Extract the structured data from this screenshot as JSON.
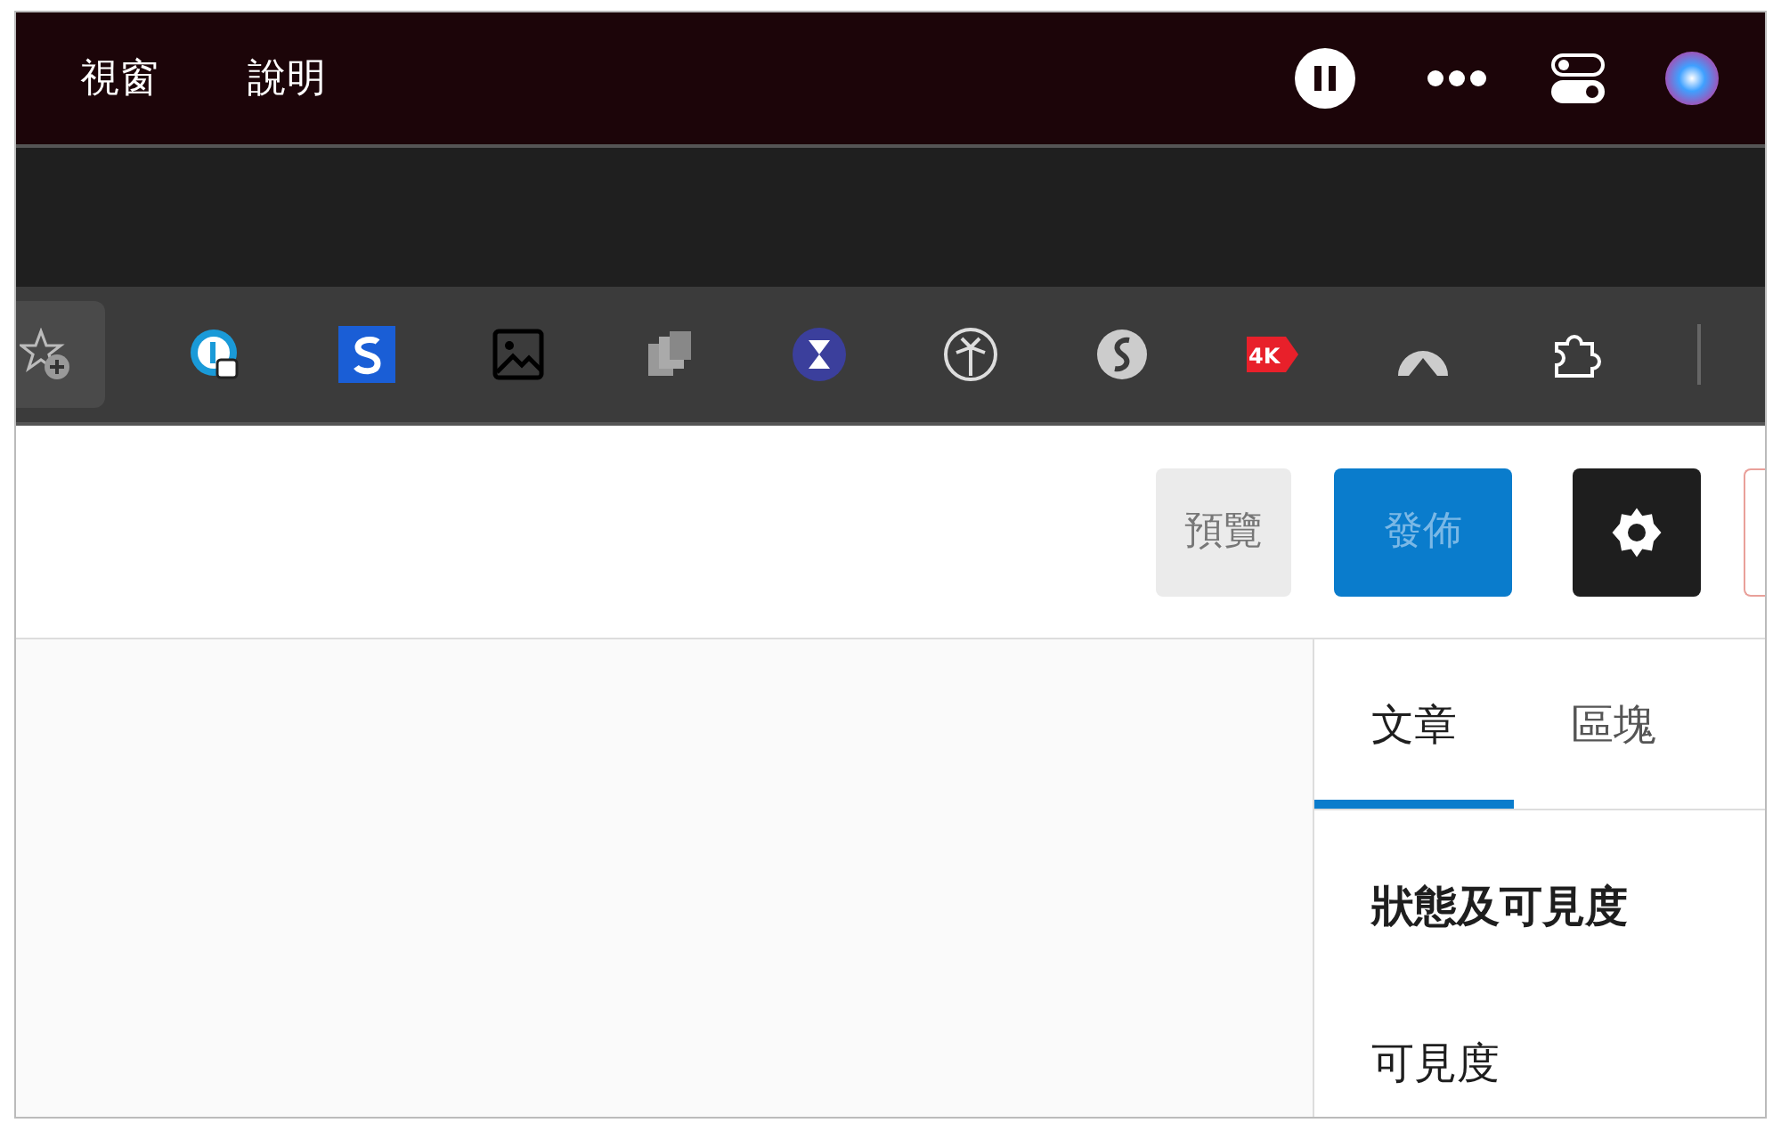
{
  "menu_bar": {
    "items": [
      "視窗",
      "說明"
    ]
  },
  "extensions_toolbar": {
    "video_badge": "4K"
  },
  "editor_toolbar": {
    "preview_button": "預覽",
    "publish_button": "發佈"
  },
  "sidebar": {
    "tabs": [
      {
        "label": "文章",
        "selected": true
      },
      {
        "label": "區塊",
        "selected": false
      }
    ],
    "section_title": "狀態及可見度",
    "field_label": "可見度"
  }
}
